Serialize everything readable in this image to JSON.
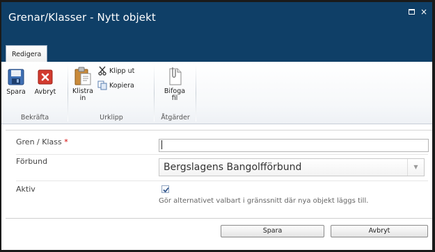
{
  "dialog": {
    "title": "Grenar/Klasser - Nytt objekt"
  },
  "window_buttons": [
    {
      "name": "maximize-icon"
    },
    {
      "name": "close-icon",
      "glyph": "×"
    }
  ],
  "ribbon": {
    "tab": "Redigera",
    "groups": {
      "bekrafta": {
        "label": "Bekräfta",
        "save": "Spara",
        "cancel": "Avbryt"
      },
      "urklipp": {
        "label": "Urklipp",
        "paste_line1": "Klistra",
        "paste_line2": "in",
        "cut": "Klipp ut",
        "copy": "Kopiera"
      },
      "atgarder": {
        "label": "Åtgärder",
        "attach_line1": "Bifoga",
        "attach_line2": "fil"
      }
    }
  },
  "form": {
    "fields": {
      "gren": {
        "label": "Gren / Klass",
        "required_marker": "*",
        "value": ""
      },
      "forbund": {
        "label": "Förbund",
        "selected": "Bergslagens Bangolfförbund"
      },
      "aktiv": {
        "label": "Aktiv",
        "checked": true,
        "description": "Gör alternativet valbart i gränssnitt där nya objekt läggs till."
      }
    },
    "buttons": {
      "save": "Spara",
      "cancel": "Avbryt"
    }
  },
  "colors": {
    "titlebar": "#0f3f67",
    "required": "#d40000"
  }
}
